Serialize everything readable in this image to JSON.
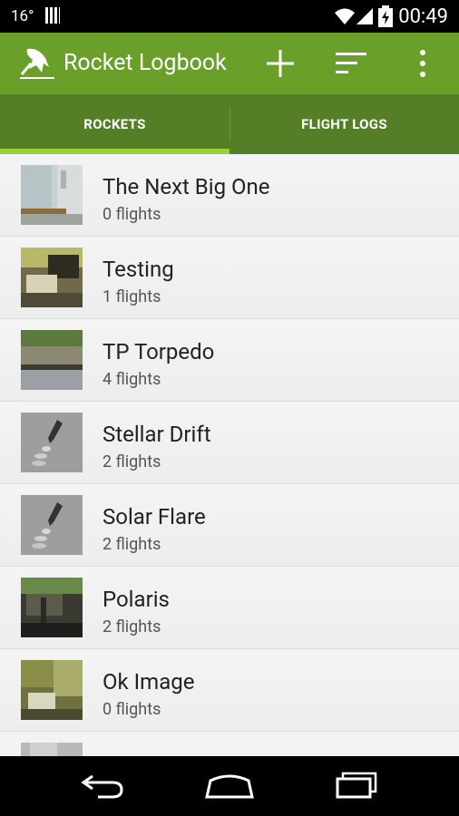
{
  "status_bar": {
    "temperature": "16°",
    "time": "00:49"
  },
  "action_bar": {
    "title": "Rocket Logbook",
    "icons": {
      "logo": "rocket-launch-icon",
      "add": "plus-icon",
      "sort": "sort-icon",
      "overflow": "more-vertical-icon"
    }
  },
  "tabs": [
    {
      "label": "ROCKETS",
      "selected": true
    },
    {
      "label": "FLIGHT LOGS",
      "selected": false
    }
  ],
  "rockets": [
    {
      "name": "The Next Big One",
      "flights": "0 flights",
      "thumb": "photo"
    },
    {
      "name": "Testing",
      "flights": "1 flights",
      "thumb": "photo"
    },
    {
      "name": "TP Torpedo",
      "flights": "4 flights",
      "thumb": "photo"
    },
    {
      "name": "Stellar Drift",
      "flights": "2 flights",
      "thumb": "rocket-placeholder"
    },
    {
      "name": "Solar Flare",
      "flights": "2 flights",
      "thumb": "rocket-placeholder"
    },
    {
      "name": "Polaris",
      "flights": "2 flights",
      "thumb": "photo"
    },
    {
      "name": "Ok Image",
      "flights": "0 flights",
      "thumb": "photo"
    }
  ],
  "nav_bar": {
    "icons": [
      "back-icon",
      "home-icon",
      "recents-icon"
    ]
  },
  "colors": {
    "action_bar": "#6aa02a",
    "tab_bar": "#557f26",
    "tab_indicator": "#9ccf3c"
  }
}
